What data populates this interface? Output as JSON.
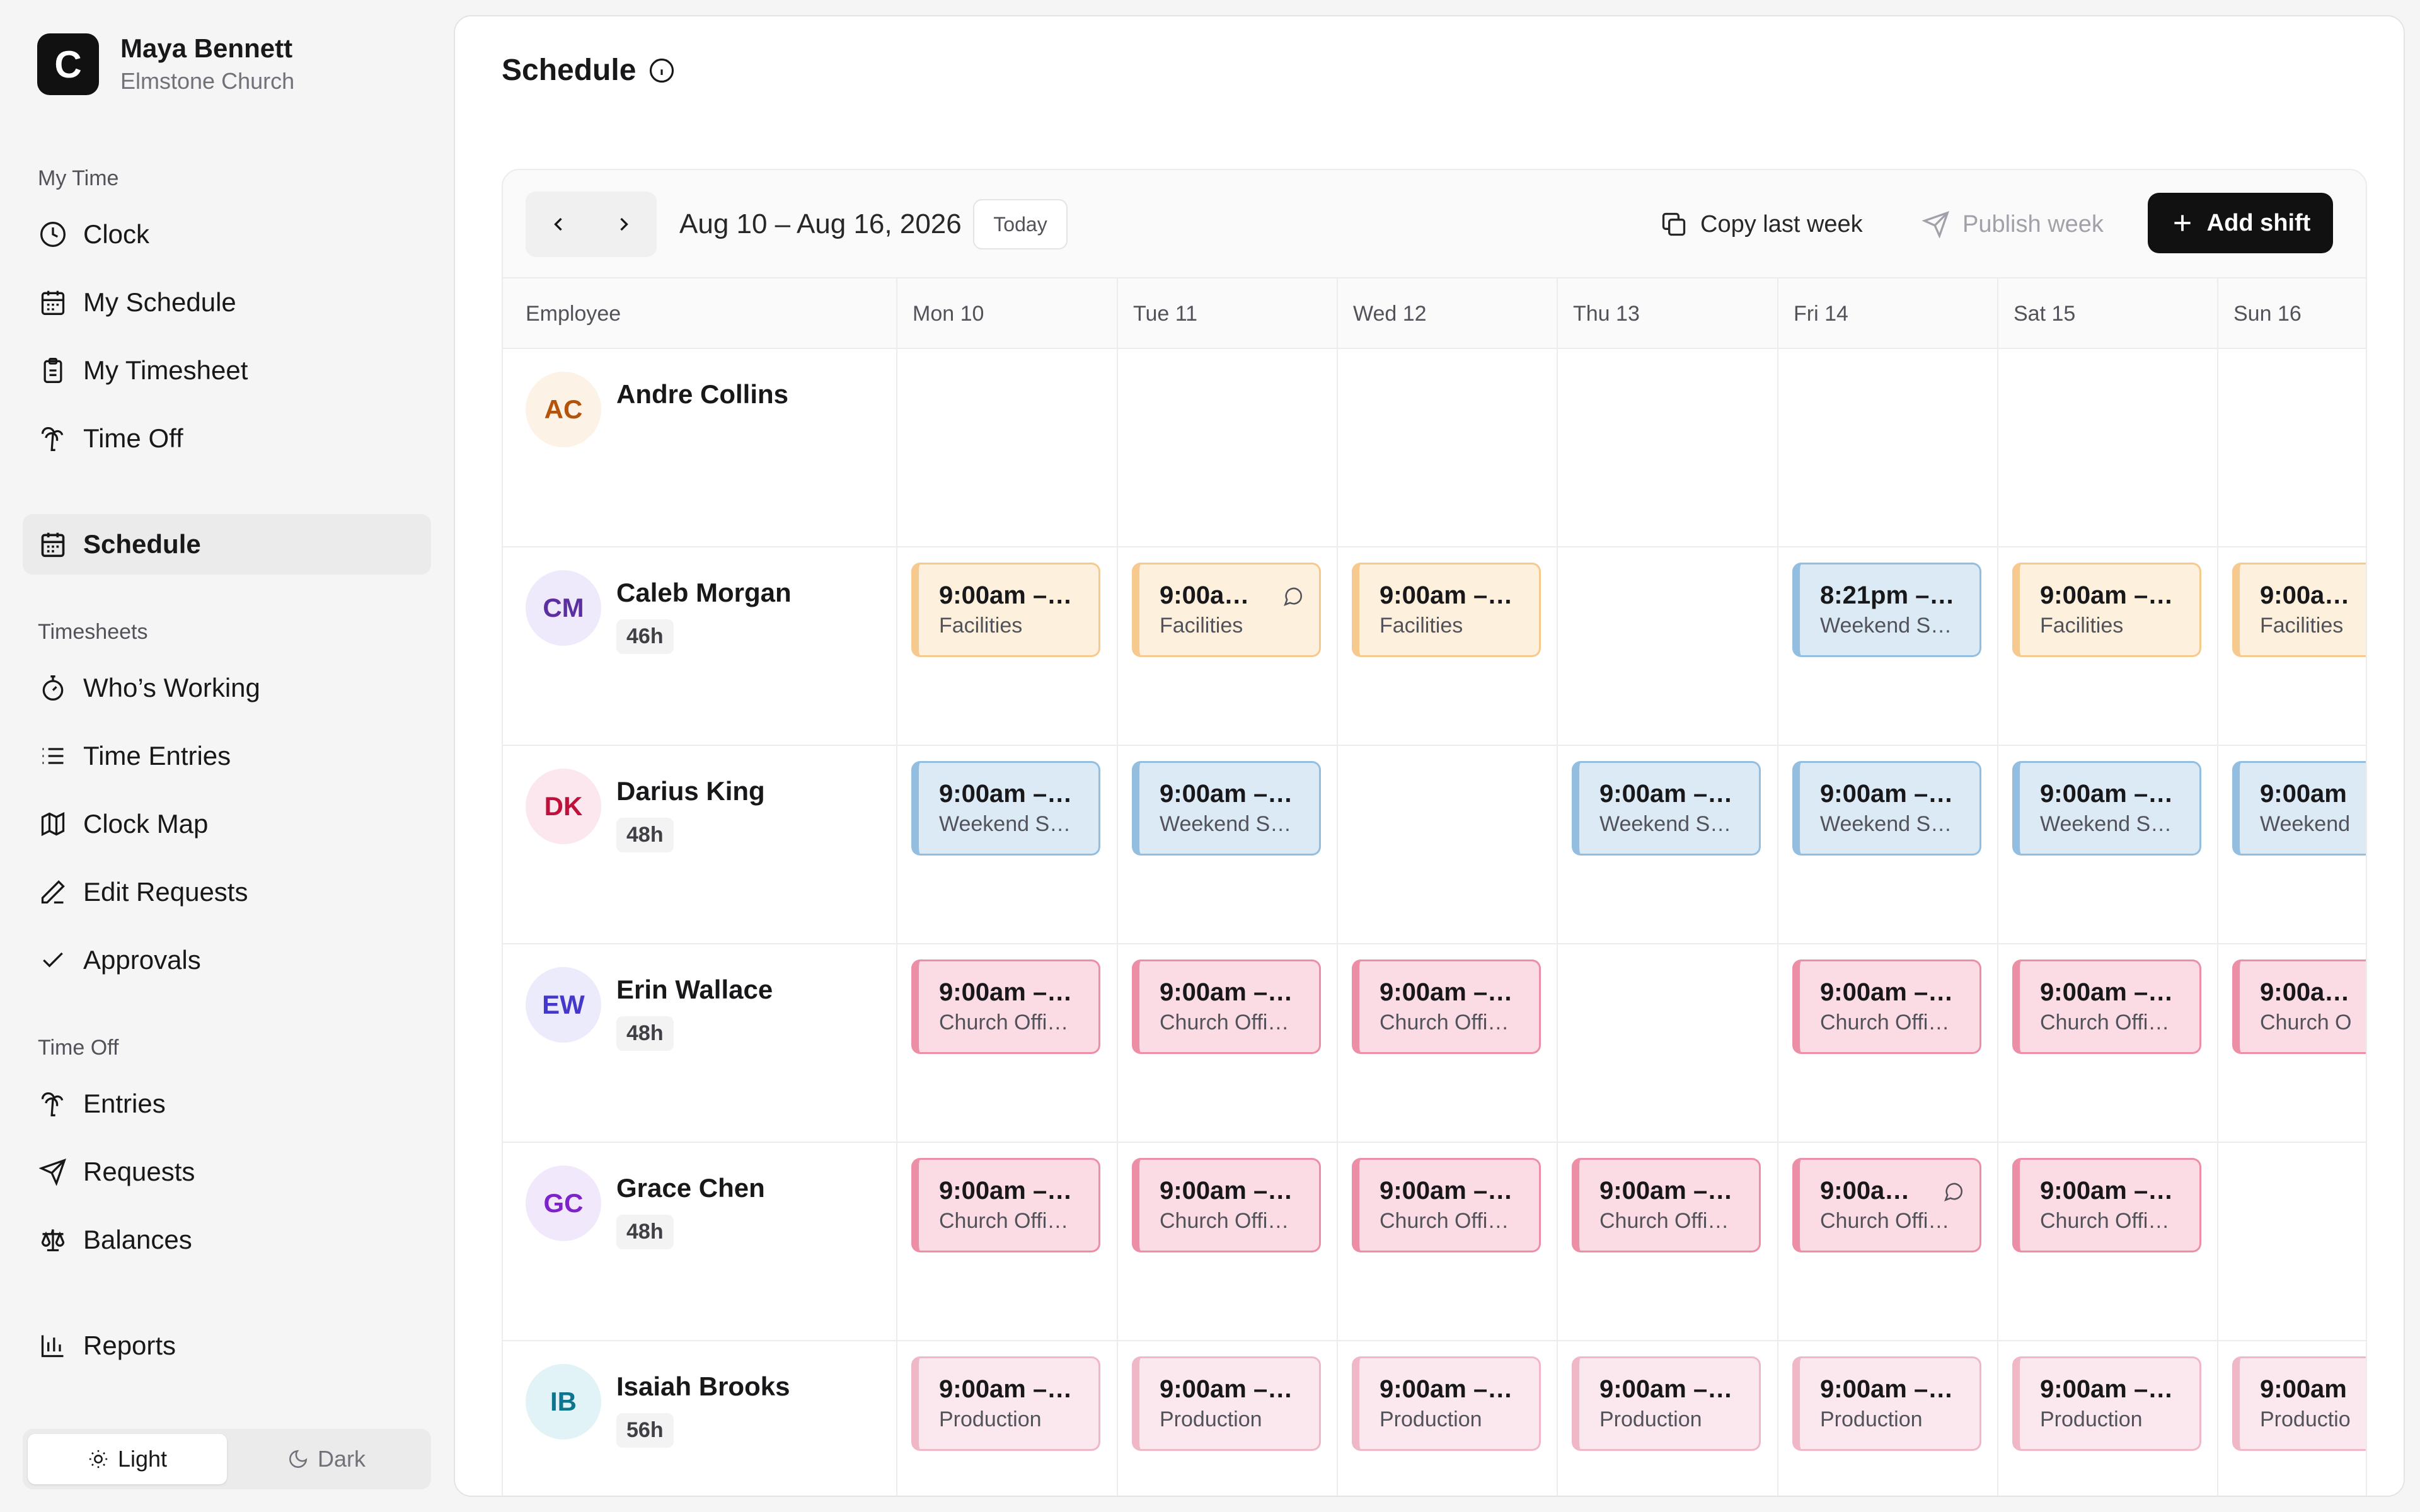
{
  "user": {
    "name": "Maya Bennett",
    "org": "Elmstone Church",
    "logo_letter": "C"
  },
  "sidebar": {
    "sections": {
      "my_time": "My Time",
      "timesheets": "Timesheets",
      "time_off": "Time Off"
    },
    "items": {
      "clock": "Clock",
      "my_schedule": "My Schedule",
      "my_timesheet": "My Timesheet",
      "time_off": "Time Off",
      "schedule": "Schedule",
      "whos_working": "Who’s Working",
      "time_entries": "Time Entries",
      "clock_map": "Clock Map",
      "edit_requests": "Edit Requests",
      "approvals": "Approvals",
      "entries": "Entries",
      "requests": "Requests",
      "balances": "Balances",
      "reports": "Reports"
    },
    "theme": {
      "light": "Light",
      "dark": "Dark",
      "selected": "Light"
    }
  },
  "page": {
    "title": "Schedule"
  },
  "toolbar": {
    "range": "Aug 10 – Aug 16, 2026",
    "today": "Today",
    "copy_last_week": "Copy last week",
    "publish_week": "Publish week",
    "add_shift": "Add shift"
  },
  "grid": {
    "employee_header": "Employee",
    "days": [
      "Mon 10",
      "Tue 11",
      "Wed 12",
      "Thu 13",
      "Fri 14",
      "Sat 15",
      "Sun 16"
    ],
    "employees": [
      {
        "initials": "AC",
        "name": "Andre Collins",
        "hours": "",
        "avatar_bg": "#fdf2e6",
        "avatar_fg": "#b45309",
        "shifts": [
          null,
          null,
          null,
          null,
          null,
          null,
          null
        ]
      },
      {
        "initials": "CM",
        "name": "Caleb Morgan",
        "hours": "46h",
        "avatar_bg": "#efeafb",
        "avatar_fg": "#5b2fa0",
        "shifts": [
          {
            "time": "9:00am –…",
            "role": "Facilities",
            "color": "orange"
          },
          {
            "time": "9:00a…",
            "role": "Facilities",
            "color": "orange",
            "notes": true
          },
          {
            "time": "9:00am –…",
            "role": "Facilities",
            "color": "orange"
          },
          null,
          {
            "time": "8:21pm –…",
            "role": "Weekend S…",
            "color": "blue"
          },
          {
            "time": "9:00am –…",
            "role": "Facilities",
            "color": "orange"
          },
          {
            "time": "9:00a…",
            "role": "Facilities",
            "color": "orange"
          }
        ]
      },
      {
        "initials": "DK",
        "name": "Darius King",
        "hours": "48h",
        "avatar_bg": "#fce7ee",
        "avatar_fg": "#be123c",
        "shifts": [
          {
            "time": "9:00am –…",
            "role": "Weekend S…",
            "color": "blue"
          },
          {
            "time": "9:00am –…",
            "role": "Weekend S…",
            "color": "blue"
          },
          null,
          {
            "time": "9:00am –…",
            "role": "Weekend S…",
            "color": "blue"
          },
          {
            "time": "9:00am –…",
            "role": "Weekend S…",
            "color": "blue"
          },
          {
            "time": "9:00am –…",
            "role": "Weekend S…",
            "color": "blue"
          },
          {
            "time": "9:00am",
            "role": "Weekend",
            "color": "blue"
          }
        ]
      },
      {
        "initials": "EW",
        "name": "Erin Wallace",
        "hours": "48h",
        "avatar_bg": "#ecebfb",
        "avatar_fg": "#4338ca",
        "shifts": [
          {
            "time": "9:00am –…",
            "role": "Church Offi…",
            "color": "pink"
          },
          {
            "time": "9:00am –…",
            "role": "Church Offi…",
            "color": "pink"
          },
          {
            "time": "9:00am –…",
            "role": "Church Offi…",
            "color": "pink"
          },
          null,
          {
            "time": "9:00am –…",
            "role": "Church Offi…",
            "color": "pink"
          },
          {
            "time": "9:00am –…",
            "role": "Church Offi…",
            "color": "pink"
          },
          {
            "time": "9:00a…",
            "role": "Church O",
            "color": "pink"
          }
        ]
      },
      {
        "initials": "GC",
        "name": "Grace Chen",
        "hours": "48h",
        "avatar_bg": "#f1e9fb",
        "avatar_fg": "#7e22ce",
        "shifts": [
          {
            "time": "9:00am –…",
            "role": "Church Offi…",
            "color": "pink"
          },
          {
            "time": "9:00am –…",
            "role": "Church Offi…",
            "color": "pink"
          },
          {
            "time": "9:00am –…",
            "role": "Church Offi…",
            "color": "pink"
          },
          {
            "time": "9:00am –…",
            "role": "Church Offi…",
            "color": "pink"
          },
          {
            "time": "9:00a…",
            "role": "Church Offi…",
            "color": "pink",
            "notes": true
          },
          {
            "time": "9:00am –…",
            "role": "Church Offi…",
            "color": "pink"
          },
          null
        ]
      },
      {
        "initials": "IB",
        "name": "Isaiah Brooks",
        "hours": "56h",
        "avatar_bg": "#e1f3f6",
        "avatar_fg": "#0e7490",
        "shifts": [
          {
            "time": "9:00am –…",
            "role": "Production",
            "color": "lpink"
          },
          {
            "time": "9:00am –…",
            "role": "Production",
            "color": "lpink"
          },
          {
            "time": "9:00am –…",
            "role": "Production",
            "color": "lpink"
          },
          {
            "time": "9:00am –…",
            "role": "Production",
            "color": "lpink"
          },
          {
            "time": "9:00am –…",
            "role": "Production",
            "color": "lpink"
          },
          {
            "time": "9:00am –…",
            "role": "Production",
            "color": "lpink"
          },
          {
            "time": "9:00am",
            "role": "Productio",
            "color": "lpink"
          }
        ]
      }
    ]
  }
}
